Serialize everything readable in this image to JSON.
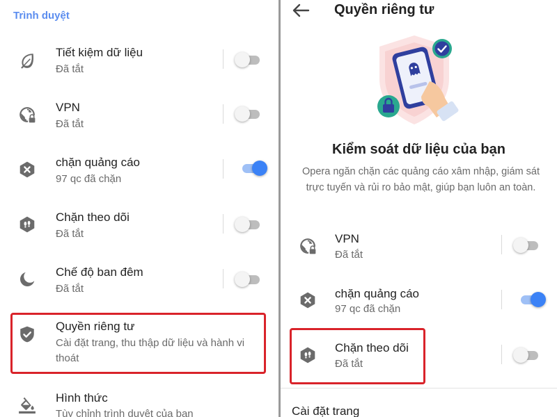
{
  "left": {
    "section_title": "Trình duyệt",
    "items": [
      {
        "title": "Tiết kiệm dữ liệu",
        "subtitle": "Đã tắt",
        "icon": "leaf-icon",
        "toggle": "off"
      },
      {
        "title": "VPN",
        "subtitle": "Đã tắt",
        "icon": "vpn-globe-lock-icon",
        "toggle": "off"
      },
      {
        "title": "chặn quảng cáo",
        "subtitle": "97 qc đã chặn",
        "icon": "ad-block-icon",
        "toggle": "on"
      },
      {
        "title": "Chặn theo dõi",
        "subtitle": "Đã tắt",
        "icon": "tracker-block-icon",
        "toggle": "off"
      },
      {
        "title": "Chế độ ban đêm",
        "subtitle": "Đã tắt",
        "icon": "moon-icon",
        "toggle": "off"
      },
      {
        "title": "Quyền riêng tư",
        "subtitle_line1": "Cài đặt trang, thu thập dữ liệu và hành vi",
        "subtitle_line2": "thoát",
        "icon": "shield-check-icon"
      },
      {
        "title": "Hình thức",
        "subtitle": "Tùy chỉnh trình duyệt của bạn",
        "icon": "paint-bucket-icon"
      }
    ]
  },
  "right": {
    "page_title": "Quyền riêng tư",
    "hero_title": "Kiểm soát dữ liệu của bạn",
    "hero_desc": "Opera ngăn chặn các quảng cáo xâm nhập, giám sát trực tuyến và rủi ro bảo mật, giúp bạn luôn an toàn.",
    "items": [
      {
        "title": "VPN",
        "subtitle": "Đã tắt",
        "icon": "vpn-globe-lock-icon",
        "toggle": "off"
      },
      {
        "title": "chặn quảng cáo",
        "subtitle": "97 qc đã chặn",
        "icon": "ad-block-icon",
        "toggle": "on"
      },
      {
        "title": "Chặn theo dõi",
        "subtitle": "Đã tắt",
        "icon": "tracker-block-icon",
        "toggle": "off"
      }
    ],
    "footer_section": "Cài đặt trang"
  },
  "colors": {
    "accent": "#3b82f6",
    "section_title": "#5b8def",
    "highlight": "#d9232a",
    "icon": "#6b6b6b"
  }
}
